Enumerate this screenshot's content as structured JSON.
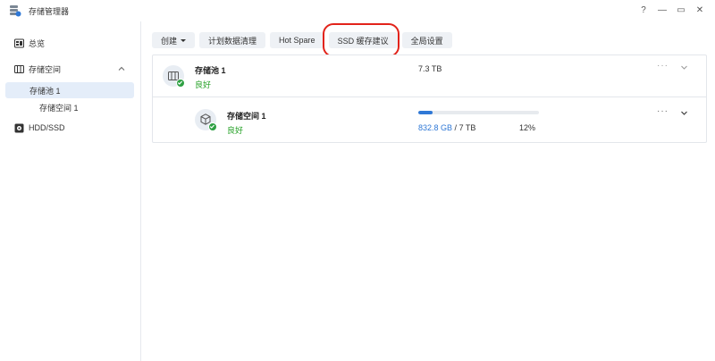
{
  "window": {
    "title": "存储管理器",
    "controls": {
      "help": "?",
      "minimize": "—",
      "maximize": "▭",
      "close": "✕"
    }
  },
  "sidebar": {
    "items": [
      {
        "label": "总览",
        "icon": "overview-icon"
      },
      {
        "label": "存储空间",
        "icon": "storage-icon"
      },
      {
        "label": "存储池 1"
      },
      {
        "label": "存储空间 1"
      },
      {
        "label": "HDD/SSD",
        "icon": "drive-icon"
      }
    ]
  },
  "toolbar": {
    "buttons": [
      "创建",
      "计划数据清理",
      "Hot Spare",
      "SSD 缓存建议",
      "全局设置"
    ]
  },
  "pool": {
    "name": "存储池 1",
    "status": "良好",
    "size": "7.3 TB",
    "more": "···"
  },
  "volume": {
    "name": "存储空间 1",
    "status": "良好",
    "used": "832.8 GB",
    "separator": "/",
    "total": "7 TB",
    "percent": "12%",
    "fraction": 0.12,
    "more": "···"
  },
  "colors": {
    "accent": "#2f78d6",
    "ok": "#2ea043",
    "highlight": "#e2231a"
  }
}
